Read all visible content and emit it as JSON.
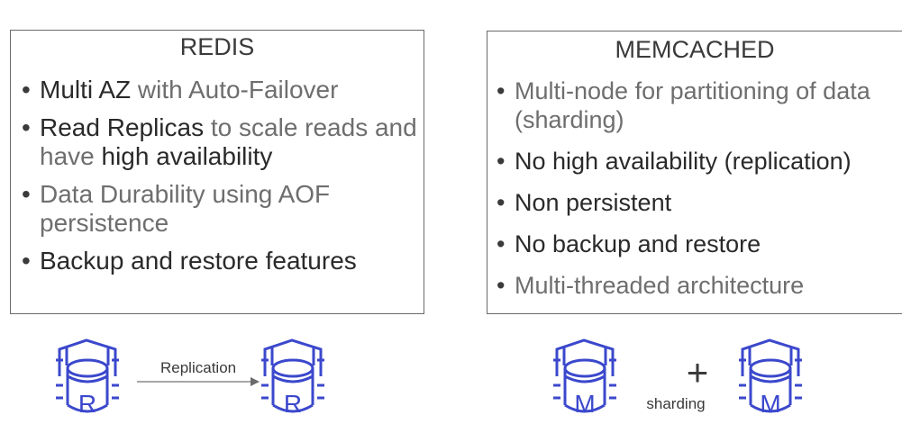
{
  "redis": {
    "title": "REDIS",
    "bullets": [
      {
        "parts": [
          {
            "text": "Multi AZ",
            "strong": true
          },
          {
            "text": " with Auto-Failover",
            "strong": false
          }
        ]
      },
      {
        "parts": [
          {
            "text": "Read Replicas",
            "strong": true
          },
          {
            "text": " to scale reads and have ",
            "strong": false
          },
          {
            "text": "high availability",
            "strong": true
          }
        ]
      },
      {
        "parts": [
          {
            "text": "Data Durability using AOF persistence",
            "strong": false
          }
        ]
      },
      {
        "parts": [
          {
            "text": "Backup and restore features",
            "strong": true
          }
        ]
      }
    ]
  },
  "memcached": {
    "title": "MEMCACHED",
    "bullets": [
      {
        "parts": [
          {
            "text": "Multi-node for partitioning of data (sharding)",
            "strong": false
          }
        ]
      },
      {
        "parts": [
          {
            "text": "No high availability (replication)",
            "strong": true
          }
        ]
      },
      {
        "parts": [
          {
            "text": "Non persistent",
            "strong": true
          }
        ]
      },
      {
        "parts": [
          {
            "text": "No backup and restore",
            "strong": true
          }
        ]
      },
      {
        "parts": [
          {
            "text": "Multi-threaded architecture",
            "strong": false
          }
        ]
      }
    ]
  },
  "diagrams": {
    "redis_label": "Replication",
    "redis_node_letter": "R",
    "memcached_plus": "+",
    "memcached_label": "sharding",
    "memcached_node_letter": "M"
  },
  "colors": {
    "icon": "#3b48cc",
    "border": "#6b6b6b"
  }
}
